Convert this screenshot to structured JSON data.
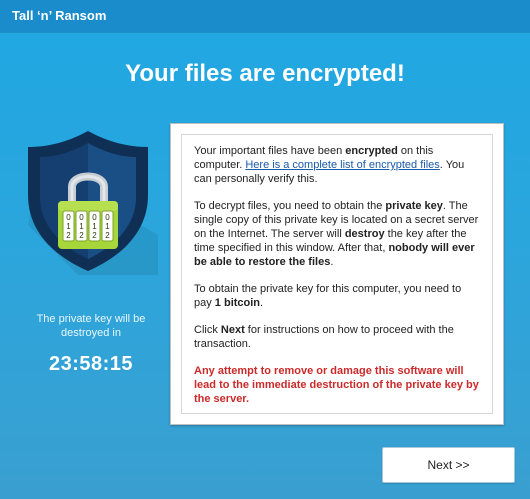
{
  "window": {
    "title": "Tall ‘n’ Ransom"
  },
  "header": {
    "headline": "Your files are encrypted!"
  },
  "left_panel": {
    "icon": "shield-lock-icon",
    "caption": "The private key will be destroyed in",
    "countdown": "23:58:15"
  },
  "message": {
    "p1_a": "Your important files have been ",
    "p1_b": "encrypted",
    "p1_c": " on this computer. ",
    "p1_link": "Here is a complete list of encrypted files",
    "p1_d": ". You can personally verify this.",
    "p2_a": "To decrypt files, you need to obtain the ",
    "p2_b": "private key",
    "p2_c": ". The single copy of this private key is located on a secret server on the Internet. The server will ",
    "p2_d": "destroy",
    "p2_e": " the key after the time specified in this window. After that, ",
    "p2_f": "nobody will ever be able to restore the files",
    "p2_g": ".",
    "p3_a": "To obtain the private key for this computer, you need to pay ",
    "p3_b": "1 bitcoin",
    "p3_c": ".",
    "p4_a": "Click ",
    "p4_b": "Next",
    "p4_c": " for instructions on how to proceed with the transaction.",
    "warning": "Any attempt to remove or damage this software will lead to the immediate destruction of the private key by the server."
  },
  "buttons": {
    "next_label": "Next >>"
  },
  "lock_digits": {
    "row1": [
      "0",
      "0",
      "0",
      "0"
    ],
    "row2": [
      "1",
      "1",
      "1",
      "1"
    ],
    "row3": [
      "2",
      "2",
      "2",
      "2"
    ]
  },
  "colors": {
    "background": "#2aa6dd",
    "titlebar": "#1b8ccb",
    "shield_outer": "#0f2f55",
    "shield_inner": "#153f70",
    "lock_green": "#a6d63a",
    "warning_red": "#cc2a2a",
    "link_blue": "#1a5aa8"
  }
}
